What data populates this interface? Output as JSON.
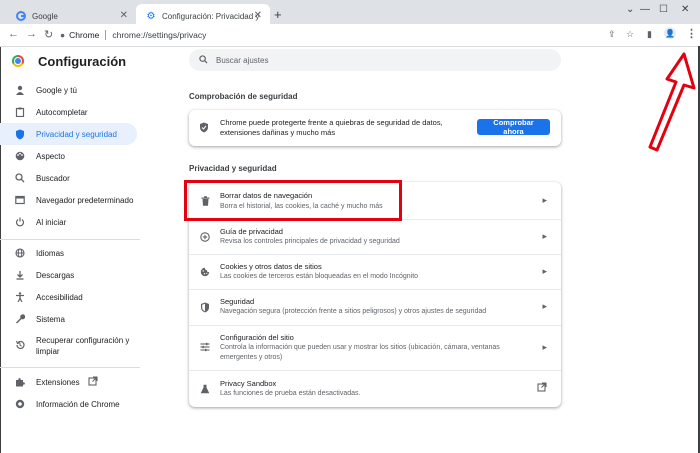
{
  "tabs": [
    {
      "label": "Google",
      "icon": "google-icon"
    },
    {
      "label": "Configuración: Privacidad y segu",
      "icon": "gear-icon"
    }
  ],
  "toolbar": {
    "host": "Chrome",
    "path": "chrome://settings/privacy"
  },
  "app": {
    "title": "Configuración"
  },
  "search": {
    "placeholder": "Buscar ajustes"
  },
  "sidebar": {
    "items": [
      {
        "label": "Google y tú",
        "icon": "person-icon"
      },
      {
        "label": "Autocompletar",
        "icon": "clipboard-icon"
      },
      {
        "label": "Privacidad y seguridad",
        "icon": "shield-icon"
      },
      {
        "label": "Aspecto",
        "icon": "palette-icon"
      },
      {
        "label": "Buscador",
        "icon": "search-icon"
      },
      {
        "label": "Navegador predeterminado",
        "icon": "browser-icon"
      },
      {
        "label": "Al iniciar",
        "icon": "power-icon"
      },
      {
        "label": "Idiomas",
        "icon": "globe-icon"
      },
      {
        "label": "Descargas",
        "icon": "download-icon"
      },
      {
        "label": "Accesibilidad",
        "icon": "accessibility-icon"
      },
      {
        "label": "Sistema",
        "icon": "wrench-icon"
      },
      {
        "label": "Recuperar configuración y",
        "label2": "limpiar",
        "icon": "restore-icon"
      },
      {
        "label": "Extensiones",
        "icon": "puzzle-icon"
      },
      {
        "label": "Información de Chrome",
        "icon": "chrome-icon"
      }
    ]
  },
  "safety": {
    "title": "Comprobación de seguridad",
    "text": "Chrome puede protegerte frente a quiebras de seguridad de datos, extensiones dañinas y mucho más",
    "button": "Comprobar ahora"
  },
  "privacy": {
    "title": "Privacidad y seguridad",
    "rows": [
      {
        "title": "Borrar datos de navegación",
        "subtitle": "Borra el historial, las cookies, la caché y mucho más",
        "icon": "trash-icon"
      },
      {
        "title": "Guía de privacidad",
        "subtitle": "Revisa los controles principales de privacidad y seguridad",
        "icon": "compass-icon"
      },
      {
        "title": "Cookies y otros datos de sitios",
        "subtitle": "Las cookies de terceros están bloqueadas en el modo Incógnito",
        "icon": "cookie-icon"
      },
      {
        "title": "Seguridad",
        "subtitle": "Navegación segura (protección frente a sitios peligrosos) y otros ajustes de seguridad",
        "icon": "shield-icon"
      },
      {
        "title": "Configuración del sitio",
        "subtitle": "Controla la información que pueden usar y mostrar los sitios (ubicación, cámara, ventanas emergentes y otros)",
        "icon": "sliders-icon"
      },
      {
        "title": "Privacy Sandbox",
        "subtitle": "Las funciones de prueba están desactivadas.",
        "icon": "flask-icon"
      }
    ]
  },
  "colors": {
    "accent": "#1a73e8",
    "highlight": "#e3000f"
  }
}
